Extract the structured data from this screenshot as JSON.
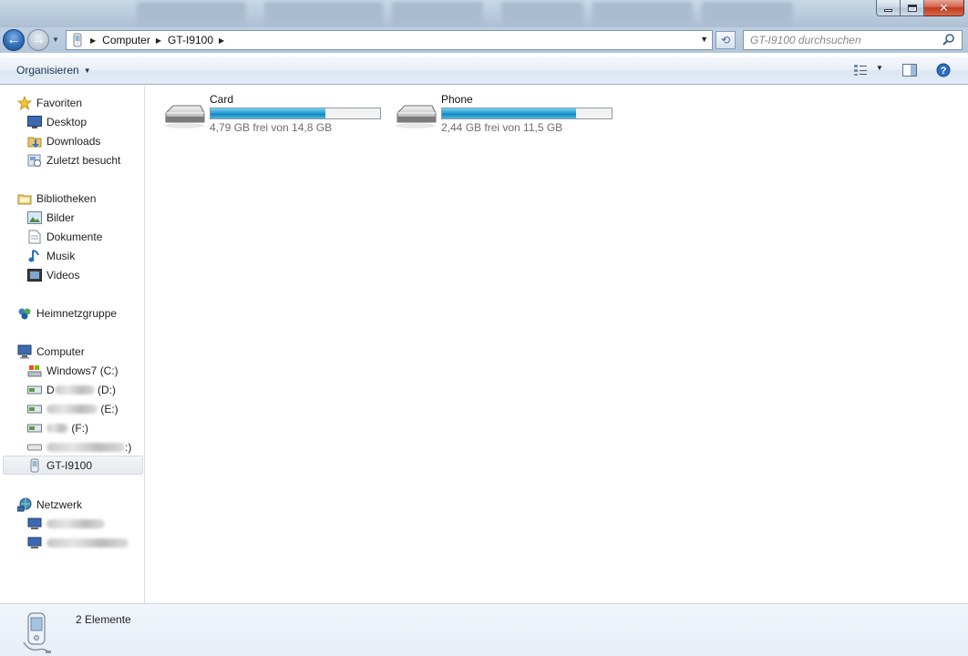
{
  "window": {
    "controls": {
      "minimize": "minimize",
      "maximize": "maximize",
      "close": "close"
    }
  },
  "navbar": {
    "breadcrumbs": [
      "Computer",
      "GT-I9100"
    ],
    "search_placeholder": "GT-I9100 durchsuchen"
  },
  "toolbar": {
    "organize_label": "Organisieren"
  },
  "sidebar": {
    "favorites": {
      "header": "Favoriten",
      "items": [
        "Desktop",
        "Downloads",
        "Zuletzt besucht"
      ]
    },
    "libraries": {
      "header": "Bibliotheken",
      "items": [
        "Bilder",
        "Dokumente",
        "Musik",
        "Videos"
      ]
    },
    "homegroup": {
      "header": "Heimnetzgruppe"
    },
    "computer": {
      "header": "Computer",
      "drives": [
        {
          "label": "Windows7 (C:)"
        },
        {
          "label_suffix": "(D:)",
          "label_prefix": "D"
        },
        {
          "label_suffix": "(E:)"
        },
        {
          "label_suffix": "(F:)"
        },
        {
          "label_suffix": ":)"
        },
        {
          "label": "GT-I9100",
          "selected": true
        }
      ]
    },
    "network": {
      "header": "Netzwerk"
    }
  },
  "content": {
    "drives": [
      {
        "name": "Card",
        "free_text": "4,79 GB frei von 14,8 GB",
        "used_fraction": 0.676
      },
      {
        "name": "Phone",
        "free_text": "2,44 GB frei von 11,5 GB",
        "used_fraction": 0.788
      }
    ]
  },
  "status": {
    "item_count": "2 Elemente"
  },
  "colors": {
    "accent": "#26a0da",
    "selection": "#e6e9ee"
  }
}
